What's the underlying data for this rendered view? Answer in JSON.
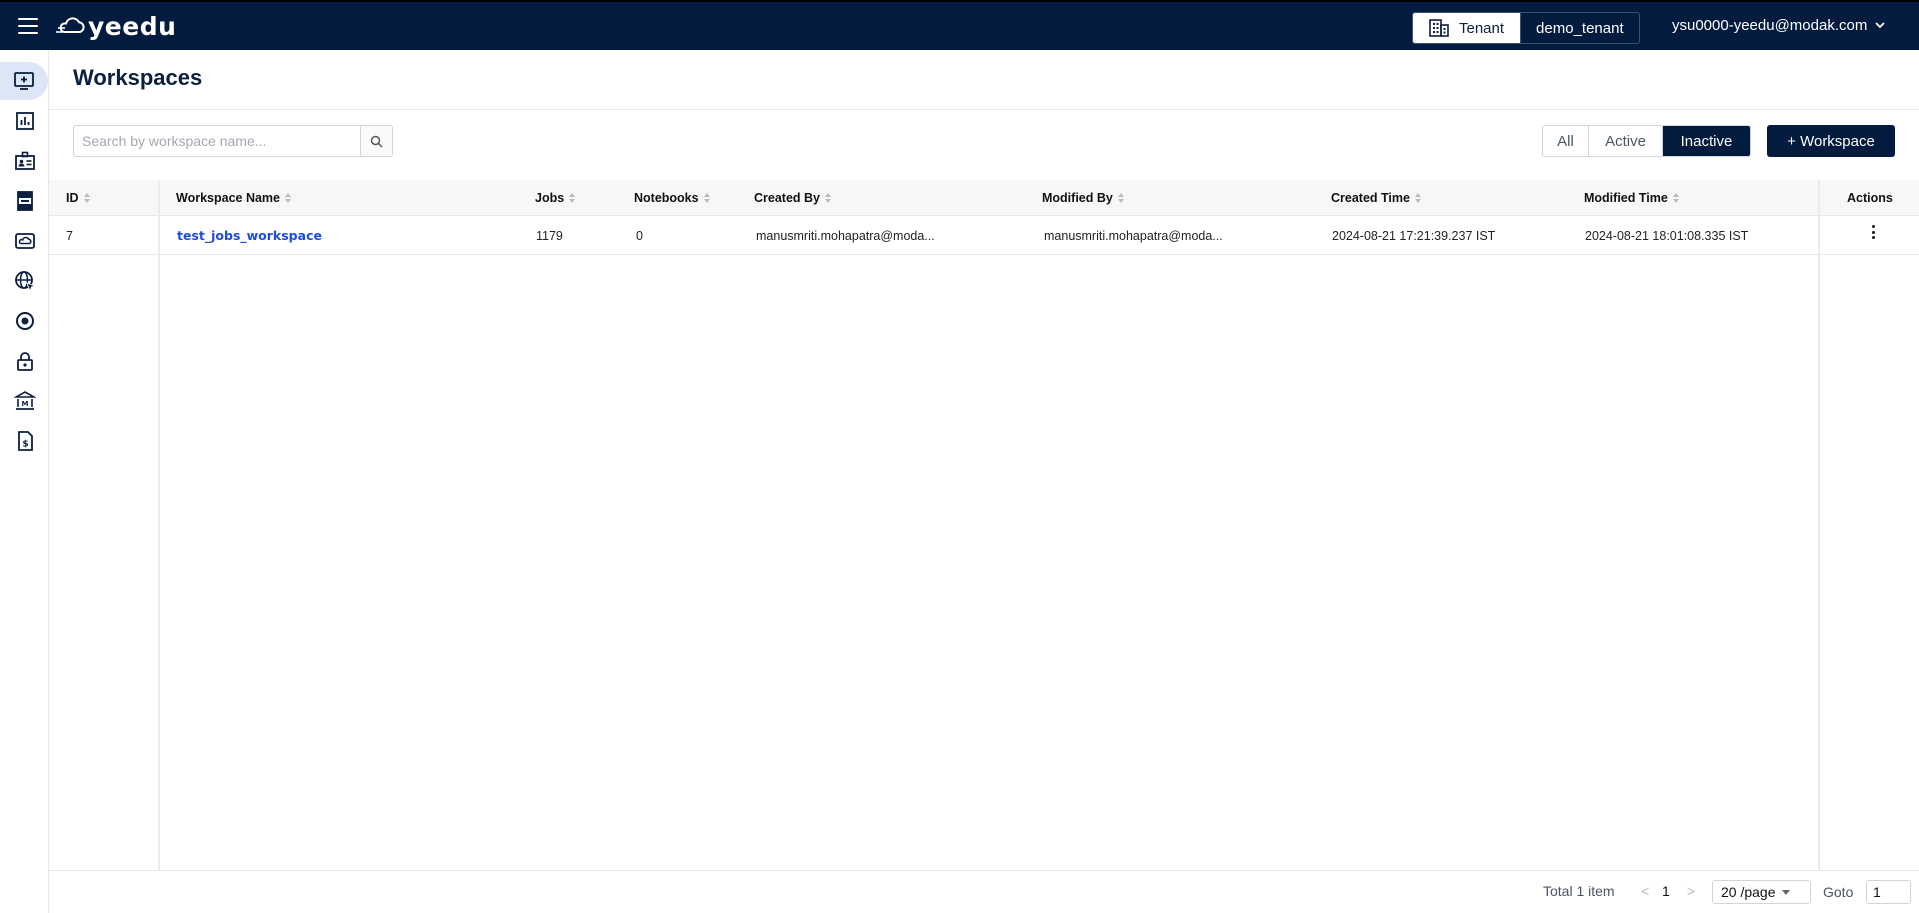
{
  "header": {
    "logo_text": "yeedu",
    "tenant_label": "Tenant",
    "tenant_value": "demo_tenant",
    "user_email": "ysu0000-yeedu@modak.com"
  },
  "sidebar": {
    "items": [
      {
        "icon": "workspace-icon",
        "active": true
      },
      {
        "icon": "bar-chart-icon"
      },
      {
        "icon": "id-card-icon"
      },
      {
        "icon": "server-rack-icon"
      },
      {
        "icon": "cloud-drive-icon"
      },
      {
        "icon": "globe-cursor-icon"
      },
      {
        "icon": "target-icon"
      },
      {
        "icon": "lock-icon"
      },
      {
        "icon": "bank-icon"
      },
      {
        "icon": "billing-icon"
      }
    ]
  },
  "page": {
    "title": "Workspaces",
    "search_placeholder": "Search by workspace name...",
    "filters": {
      "all": "All",
      "active": "Active",
      "inactive": "Inactive",
      "selected": "Inactive"
    },
    "add_button": "+ Workspace"
  },
  "table": {
    "columns": {
      "id": "ID",
      "name": "Workspace Name",
      "jobs": "Jobs",
      "notebooks": "Notebooks",
      "created_by": "Created By",
      "modified_by": "Modified By",
      "created_time": "Created Time",
      "modified_time": "Modified Time",
      "actions": "Actions"
    },
    "rows": [
      {
        "id": "7",
        "name": "test_jobs_workspace",
        "jobs": "1179",
        "notebooks": "0",
        "created_by": "manusmriti.mohapatra@moda...",
        "modified_by": "manusmriti.mohapatra@moda...",
        "created_time": "2024-08-21 17:21:39.237 IST",
        "modified_time": "2024-08-21 18:01:08.335 IST"
      }
    ]
  },
  "pagination": {
    "total_text": "Total 1 item",
    "prev": "<",
    "current_page": "1",
    "next": ">",
    "per_page": "20 /page",
    "goto_label": "Goto",
    "goto_value": "1"
  },
  "colors": {
    "navy": "#021b3f",
    "link": "#1d4ed8",
    "active_sidebar": "#dde6f6"
  }
}
